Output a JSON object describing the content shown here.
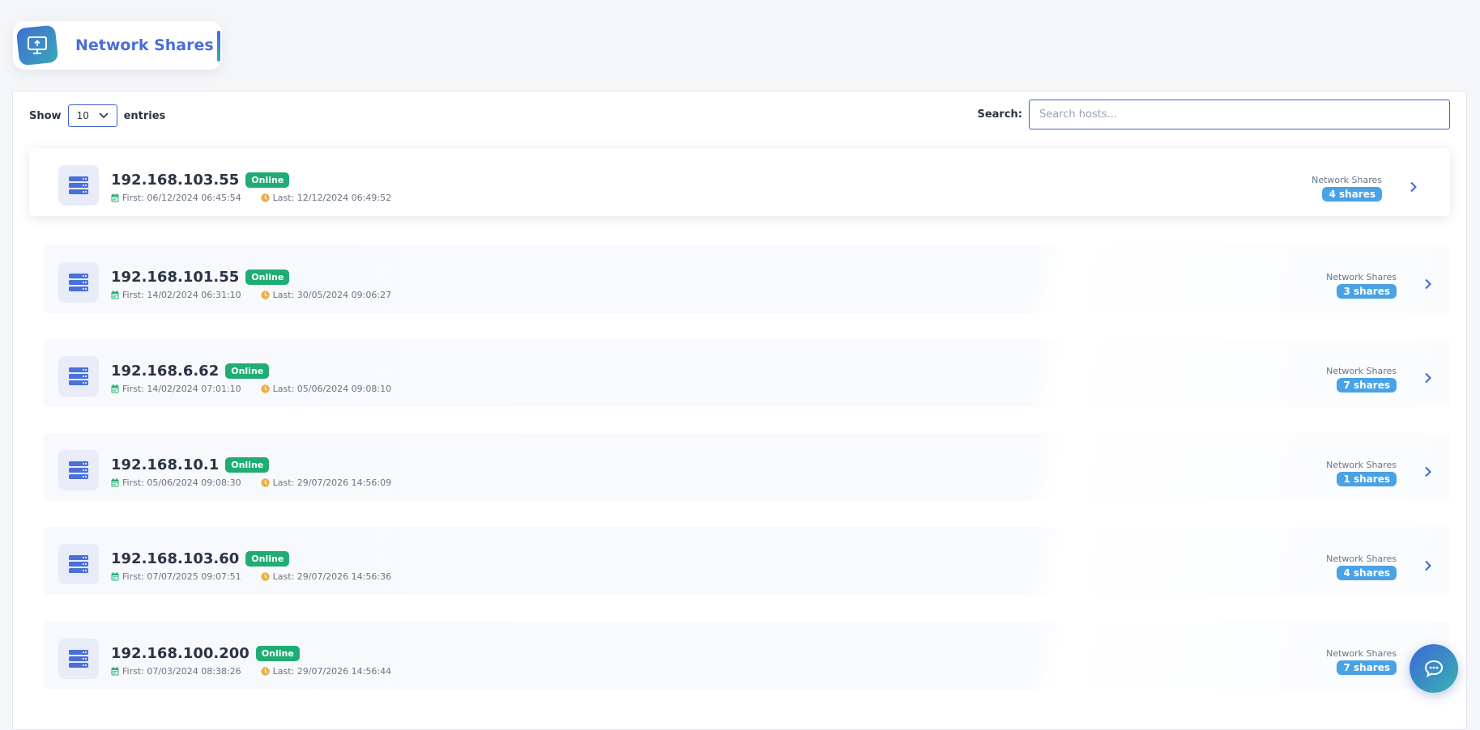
{
  "header": {
    "title": "Network Shares",
    "icon": "monitor-upload-icon",
    "accent_color": "#4a6fd8"
  },
  "controls": {
    "show_label": "Show",
    "entries_value": "10",
    "entries_label": "entries",
    "search_label": "Search:",
    "search_placeholder": "Search hosts...",
    "search_value": ""
  },
  "hosts": [
    {
      "ip": "192.168.103.55",
      "status": "Online",
      "first": "First: 06/12/2024 06:45:54",
      "last": "Last: 12/12/2024 06:49:52",
      "shares_label": "Network Shares",
      "shares": "4 shares"
    },
    {
      "ip": "192.168.101.55",
      "status": "Online",
      "first": "First: 14/02/2024 06:31:10",
      "last": "Last: 30/05/2024 09:06:27",
      "shares_label": "Network Shares",
      "shares": "3 shares"
    },
    {
      "ip": "192.168.6.62",
      "status": "Online",
      "first": "First: 14/02/2024 07:01:10",
      "last": "Last: 05/06/2024 09:08:10",
      "shares_label": "Network Shares",
      "shares": "7 shares"
    },
    {
      "ip": "192.168.10.1",
      "status": "Online",
      "first": "First: 05/06/2024 09:08:30",
      "last": "Last: 29/07/2026 14:56:09",
      "shares_label": "Network Shares",
      "shares": "1 shares"
    },
    {
      "ip": "192.168.103.60",
      "status": "Online",
      "first": "First: 07/07/2025 09:07:51",
      "last": "Last: 29/07/2026 14:56:36",
      "shares_label": "Network Shares",
      "shares": "4 shares"
    },
    {
      "ip": "192.168.100.200",
      "status": "Online",
      "first": "First: 07/03/2024 08:38:26",
      "last": "Last: 29/07/2026 14:56:44",
      "shares_label": "Network Shares",
      "shares": "7 shares"
    }
  ],
  "colors": {
    "online": "#1fad74",
    "shares_badge": "#4aa2e6",
    "calendar_icon": "#1fad74",
    "clock_icon": "#e8b04a"
  },
  "chat": {
    "icon": "chat-bubble-icon"
  }
}
